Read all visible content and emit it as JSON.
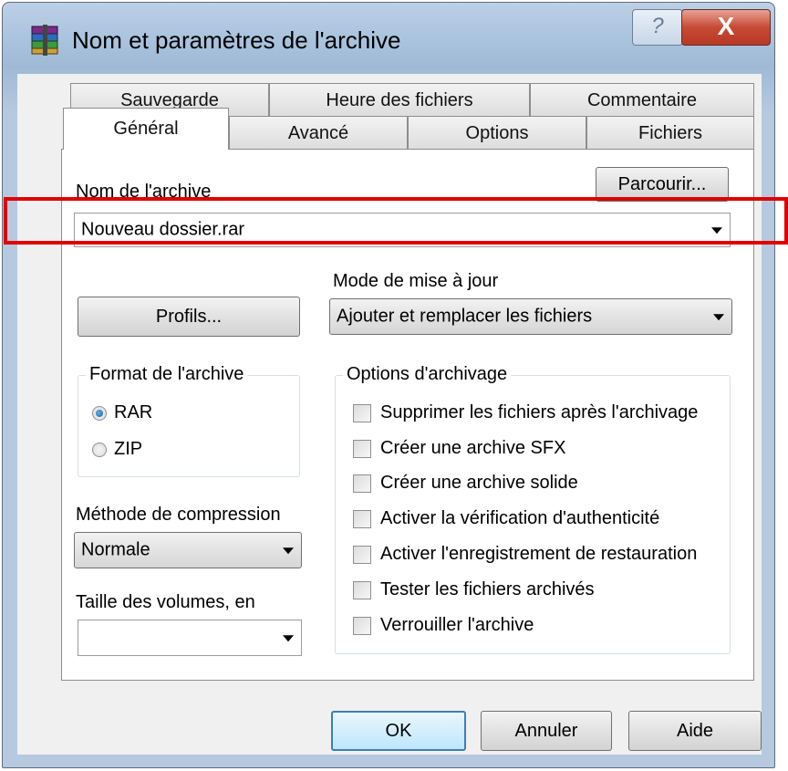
{
  "window": {
    "title": "Nom et paramètres de l'archive",
    "help_glyph": "?",
    "close_glyph": "X"
  },
  "tabs_back": [
    "Sauvegarde",
    "Heure des fichiers",
    "Commentaire"
  ],
  "tabs_front": [
    "Général",
    "Avancé",
    "Options",
    "Fichiers"
  ],
  "archive_name": {
    "label": "Nom de l'archive",
    "value": "Nouveau dossier.rar",
    "browse_label": "Parcourir..."
  },
  "update_mode": {
    "label": "Mode de mise à jour",
    "value": "Ajouter et remplacer les fichiers"
  },
  "profiles_label": "Profils...",
  "archive_format": {
    "label": "Format de l'archive",
    "options": [
      "RAR",
      "ZIP"
    ],
    "selected": "RAR"
  },
  "archiving_options": {
    "label": "Options d'archivage",
    "items": [
      "Supprimer les fichiers après l'archivage",
      "Créer une archive SFX",
      "Créer une archive solide",
      "Activer la vérification d'authenticité",
      "Activer l'enregistrement de restauration",
      "Tester les fichiers archivés",
      "Verrouiller l'archive"
    ]
  },
  "compression": {
    "label": "Méthode de compression",
    "value": "Normale"
  },
  "volume_size": {
    "label": "Taille des volumes, en",
    "value": ""
  },
  "footer": {
    "ok": "OK",
    "cancel": "Annuler",
    "help": "Aide"
  },
  "colors": {
    "highlight": "#e00000",
    "close_button": "#c74a36",
    "radio_dot": "#1b5f9a"
  },
  "icons": {
    "app": "winrar-books-icon"
  }
}
